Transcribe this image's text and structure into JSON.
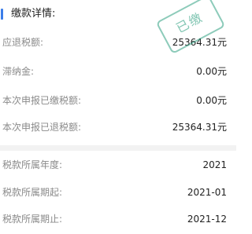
{
  "section": {
    "title": "缴款详情:"
  },
  "stamp": {
    "text": "已缴",
    "color": "#2fa081"
  },
  "rows_top": [
    {
      "label": "应退税额:",
      "value": "25364.31元"
    },
    {
      "label": "滞纳金:",
      "value": "0.00元"
    },
    {
      "label": "本次申报已缴税额:",
      "value": "0.00元"
    },
    {
      "label": "本次申报已退税额:",
      "value": "25364.31元"
    }
  ],
  "rows_bottom": [
    {
      "label": "税款所属年度:",
      "value": "2021"
    },
    {
      "label": "税款所属期起:",
      "value": "2021-01"
    },
    {
      "label": "税款所属期止:",
      "value": "2021-12"
    }
  ],
  "colors": {
    "accent": "#3b7de9",
    "label": "#8a8a8a",
    "value": "#222222",
    "divider": "#f2f2f2"
  }
}
